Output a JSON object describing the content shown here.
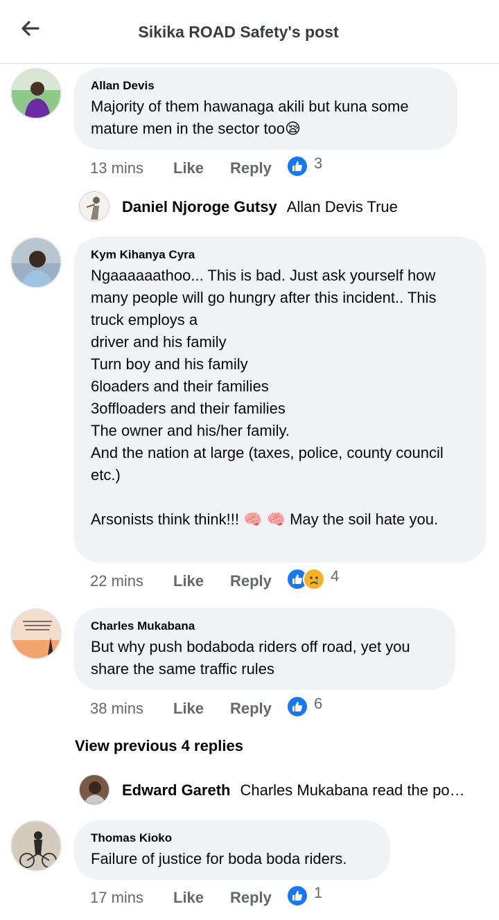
{
  "header": {
    "title": "Sikika ROAD Safety's post"
  },
  "labels": {
    "like": "Like",
    "reply": "Reply"
  },
  "comments": [
    {
      "author": "Allan Devis",
      "text": "Majority of them hawanaga akili but kuna some mature men in the sector too😪",
      "time": "13 mins",
      "reaction_count": "3"
    },
    {
      "author": "Kym Kihanya Cyra",
      "text": "Ngaaaaaathoo... This is bad. Just ask yourself how many people will go hungry after this incident.. This truck employs a\ndriver and his family\nTurn boy and his family\n6loaders and their families\n3offloaders and their families\nThe owner and his/her family.\nAnd the nation at large (taxes, police, county council etc.)\n\nArsonists think think!!! 🧠 🧠 May the soil hate you.",
      "time": "22 mins",
      "reaction_count": "4"
    },
    {
      "author": "Charles Mukabana",
      "text": "But why push bodaboda riders off road, yet you share the same traffic rules",
      "time": "38 mins",
      "reaction_count": "6"
    },
    {
      "author": "Thomas Kioko",
      "text": "Failure of justice for boda boda riders.",
      "time": "17 mins",
      "reaction_count": "1"
    }
  ],
  "replies": [
    {
      "author": "Daniel Njoroge Gutsy",
      "text": "Allan Devis True"
    },
    {
      "author": "Edward Gareth",
      "text": "Charles Mukabana read the post..."
    }
  ],
  "view_previous": "View previous 4 replies",
  "colors": {
    "like_blue": "#1877f2",
    "bubble_bg": "#f0f2f5",
    "meta_gray": "#65676b"
  }
}
